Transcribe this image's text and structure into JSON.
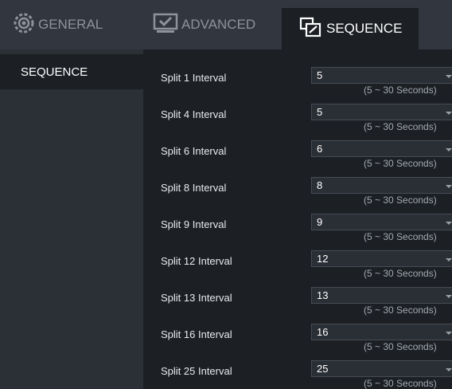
{
  "tabs": {
    "general": "GENERAL",
    "advanced": "ADVANCED",
    "sequence": "SEQUENCE"
  },
  "sidebar": {
    "items": [
      {
        "label": "SEQUENCE"
      }
    ]
  },
  "rows": [
    {
      "label": "Split 1 Interval",
      "value": "5",
      "hint": "(5 ~ 30 Seconds)"
    },
    {
      "label": "Split 4 Interval",
      "value": "5",
      "hint": "(5 ~ 30 Seconds)"
    },
    {
      "label": "Split 6 Interval",
      "value": "6",
      "hint": "(5 ~ 30 Seconds)"
    },
    {
      "label": "Split 8 Interval",
      "value": "8",
      "hint": "(5 ~ 30 Seconds)"
    },
    {
      "label": "Split 9 Interval",
      "value": "9",
      "hint": "(5 ~ 30 Seconds)"
    },
    {
      "label": "Split 12 Interval",
      "value": "12",
      "hint": "(5 ~ 30 Seconds)"
    },
    {
      "label": "Split 13 Interval",
      "value": "13",
      "hint": "(5 ~ 30 Seconds)"
    },
    {
      "label": "Split 16 Interval",
      "value": "16",
      "hint": "(5 ~ 30 Seconds)"
    },
    {
      "label": "Split 25 Interval",
      "value": "25",
      "hint": "(5 ~ 30 Seconds)"
    }
  ]
}
